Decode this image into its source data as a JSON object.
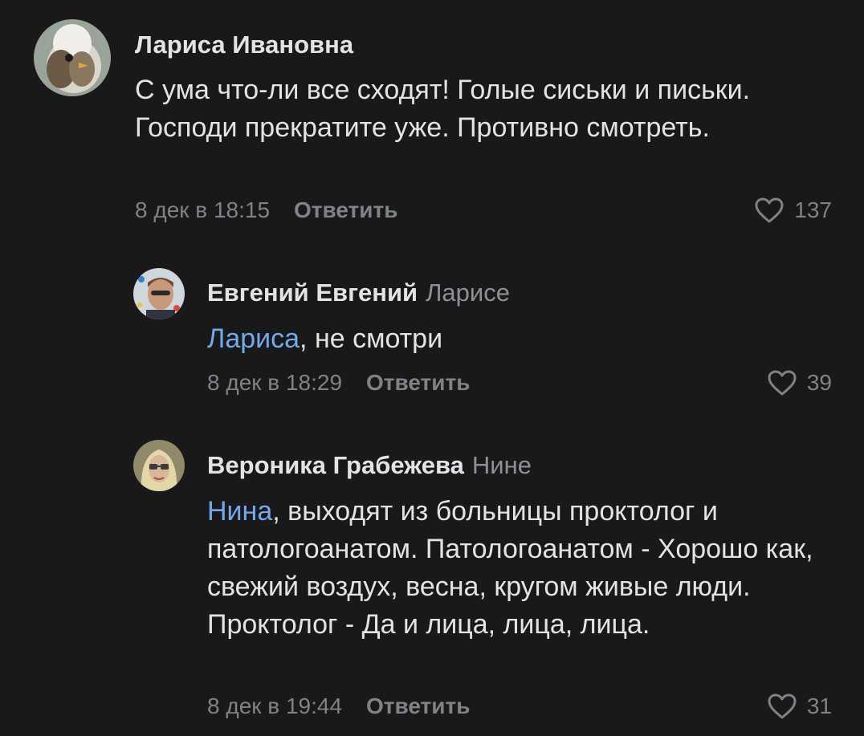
{
  "comments": [
    {
      "author": "Лариса Ивановна",
      "reply_to": "",
      "mention": "",
      "text": "С ума что-ли все сходят!  Голые сиськи и письки.  Господи прекратите уже.  Противно смотреть.",
      "date": "8 дек в 18:15",
      "reply_label": "Ответить",
      "likes": "137"
    },
    {
      "author": "Евгений Евгений",
      "reply_to": "Ларисе",
      "mention": "Лариса",
      "text": ", не смотри",
      "date": "8 дек в 18:29",
      "reply_label": "Ответить",
      "likes": "39"
    },
    {
      "author": "Вероника Грабежева",
      "reply_to": "Нине",
      "mention": "Нина",
      "text": ", выходят из больницы проктолог и патологоанатом. Патологоанатом - Хорошо как, свежий воздух, весна, кругом живые люди. Проктолог - Да и лица, лица, лица.",
      "date": "8 дек в 19:44",
      "reply_label": "Ответить",
      "likes": "31"
    }
  ],
  "colors": {
    "background": "#19191a",
    "text": "#e1e3e6",
    "secondary": "#7f8287",
    "mention": "#71aaeb"
  }
}
